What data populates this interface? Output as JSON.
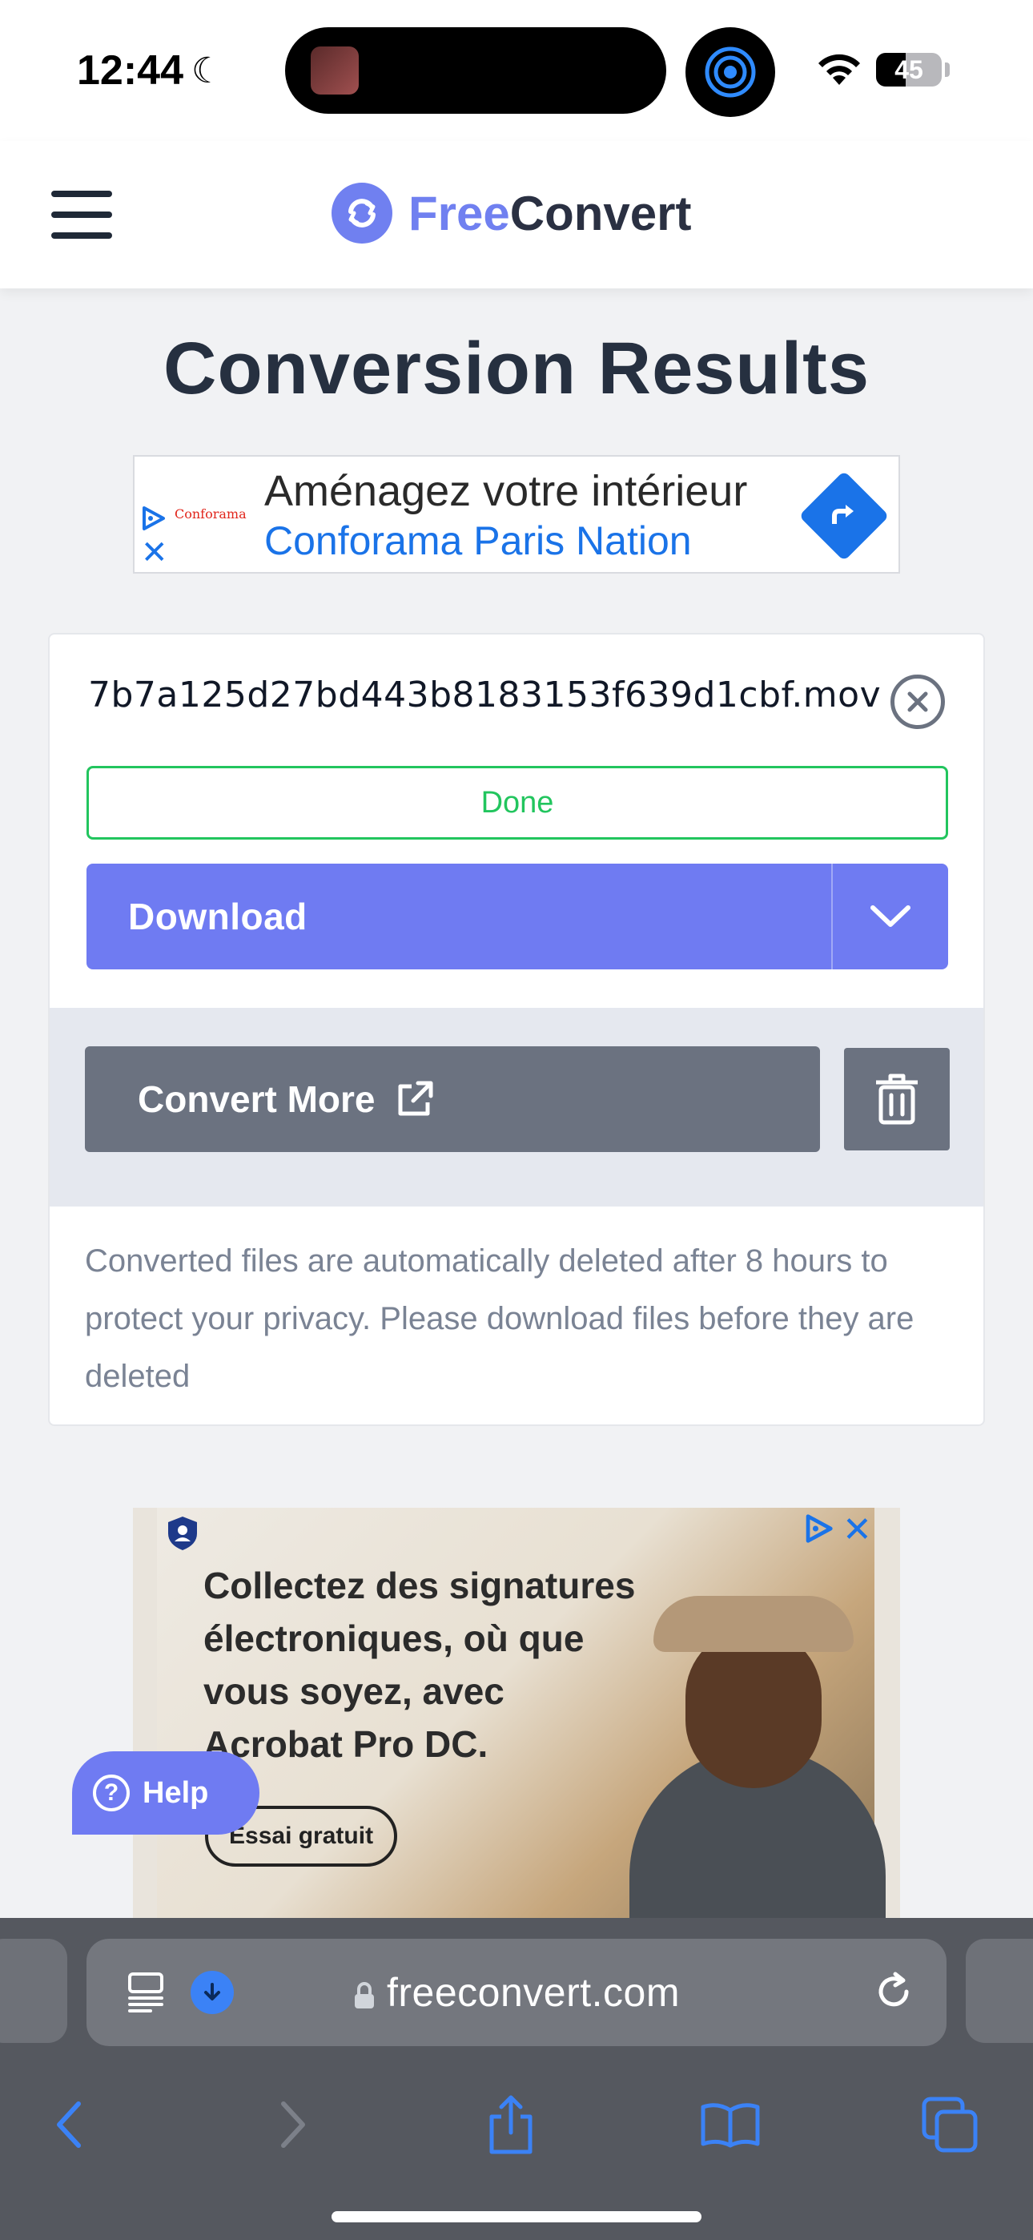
{
  "status_bar": {
    "time": "12:44",
    "battery_level": "45",
    "battery_fraction": 0.45,
    "icons": [
      "moon-icon",
      "airdrop-icon",
      "wifi-icon",
      "battery-icon"
    ]
  },
  "header": {
    "logo_free": "Free",
    "logo_convert": "Convert",
    "menu_icon": "hamburger-icon",
    "brand_color": "#7080f0"
  },
  "page": {
    "title": "Conversion Results"
  },
  "ad_top": {
    "brand": "Conforama",
    "headline": "Aménagez votre intérieur",
    "subline": "Conforama Paris Nation",
    "close": "✕"
  },
  "result": {
    "file_name": "7b7a125d27bd443b8183153f639d1cbf.mov",
    "status": "Done",
    "status_color": "#22c55e",
    "download_label": "Download",
    "convert_more_label": "Convert More",
    "notice": "Converted files are automatically deleted after 8 hours to protect your privacy. Please download files before they are deleted",
    "accent_color": "#6f7bf2"
  },
  "ad_bottom": {
    "text": "Collectez des signatures électroniques, où que vous soyez, avec Acrobat Pro DC.",
    "cta": "Essai gratuit",
    "close": "✕"
  },
  "help": {
    "label": "Help",
    "icon_glyph": "?"
  },
  "browser": {
    "url": "freeconvert.com",
    "icons": [
      "reader-icon",
      "download-icon",
      "lock-icon",
      "reload-icon",
      "back-icon",
      "forward-icon",
      "share-icon",
      "bookmarks-icon",
      "tabs-icon"
    ]
  }
}
